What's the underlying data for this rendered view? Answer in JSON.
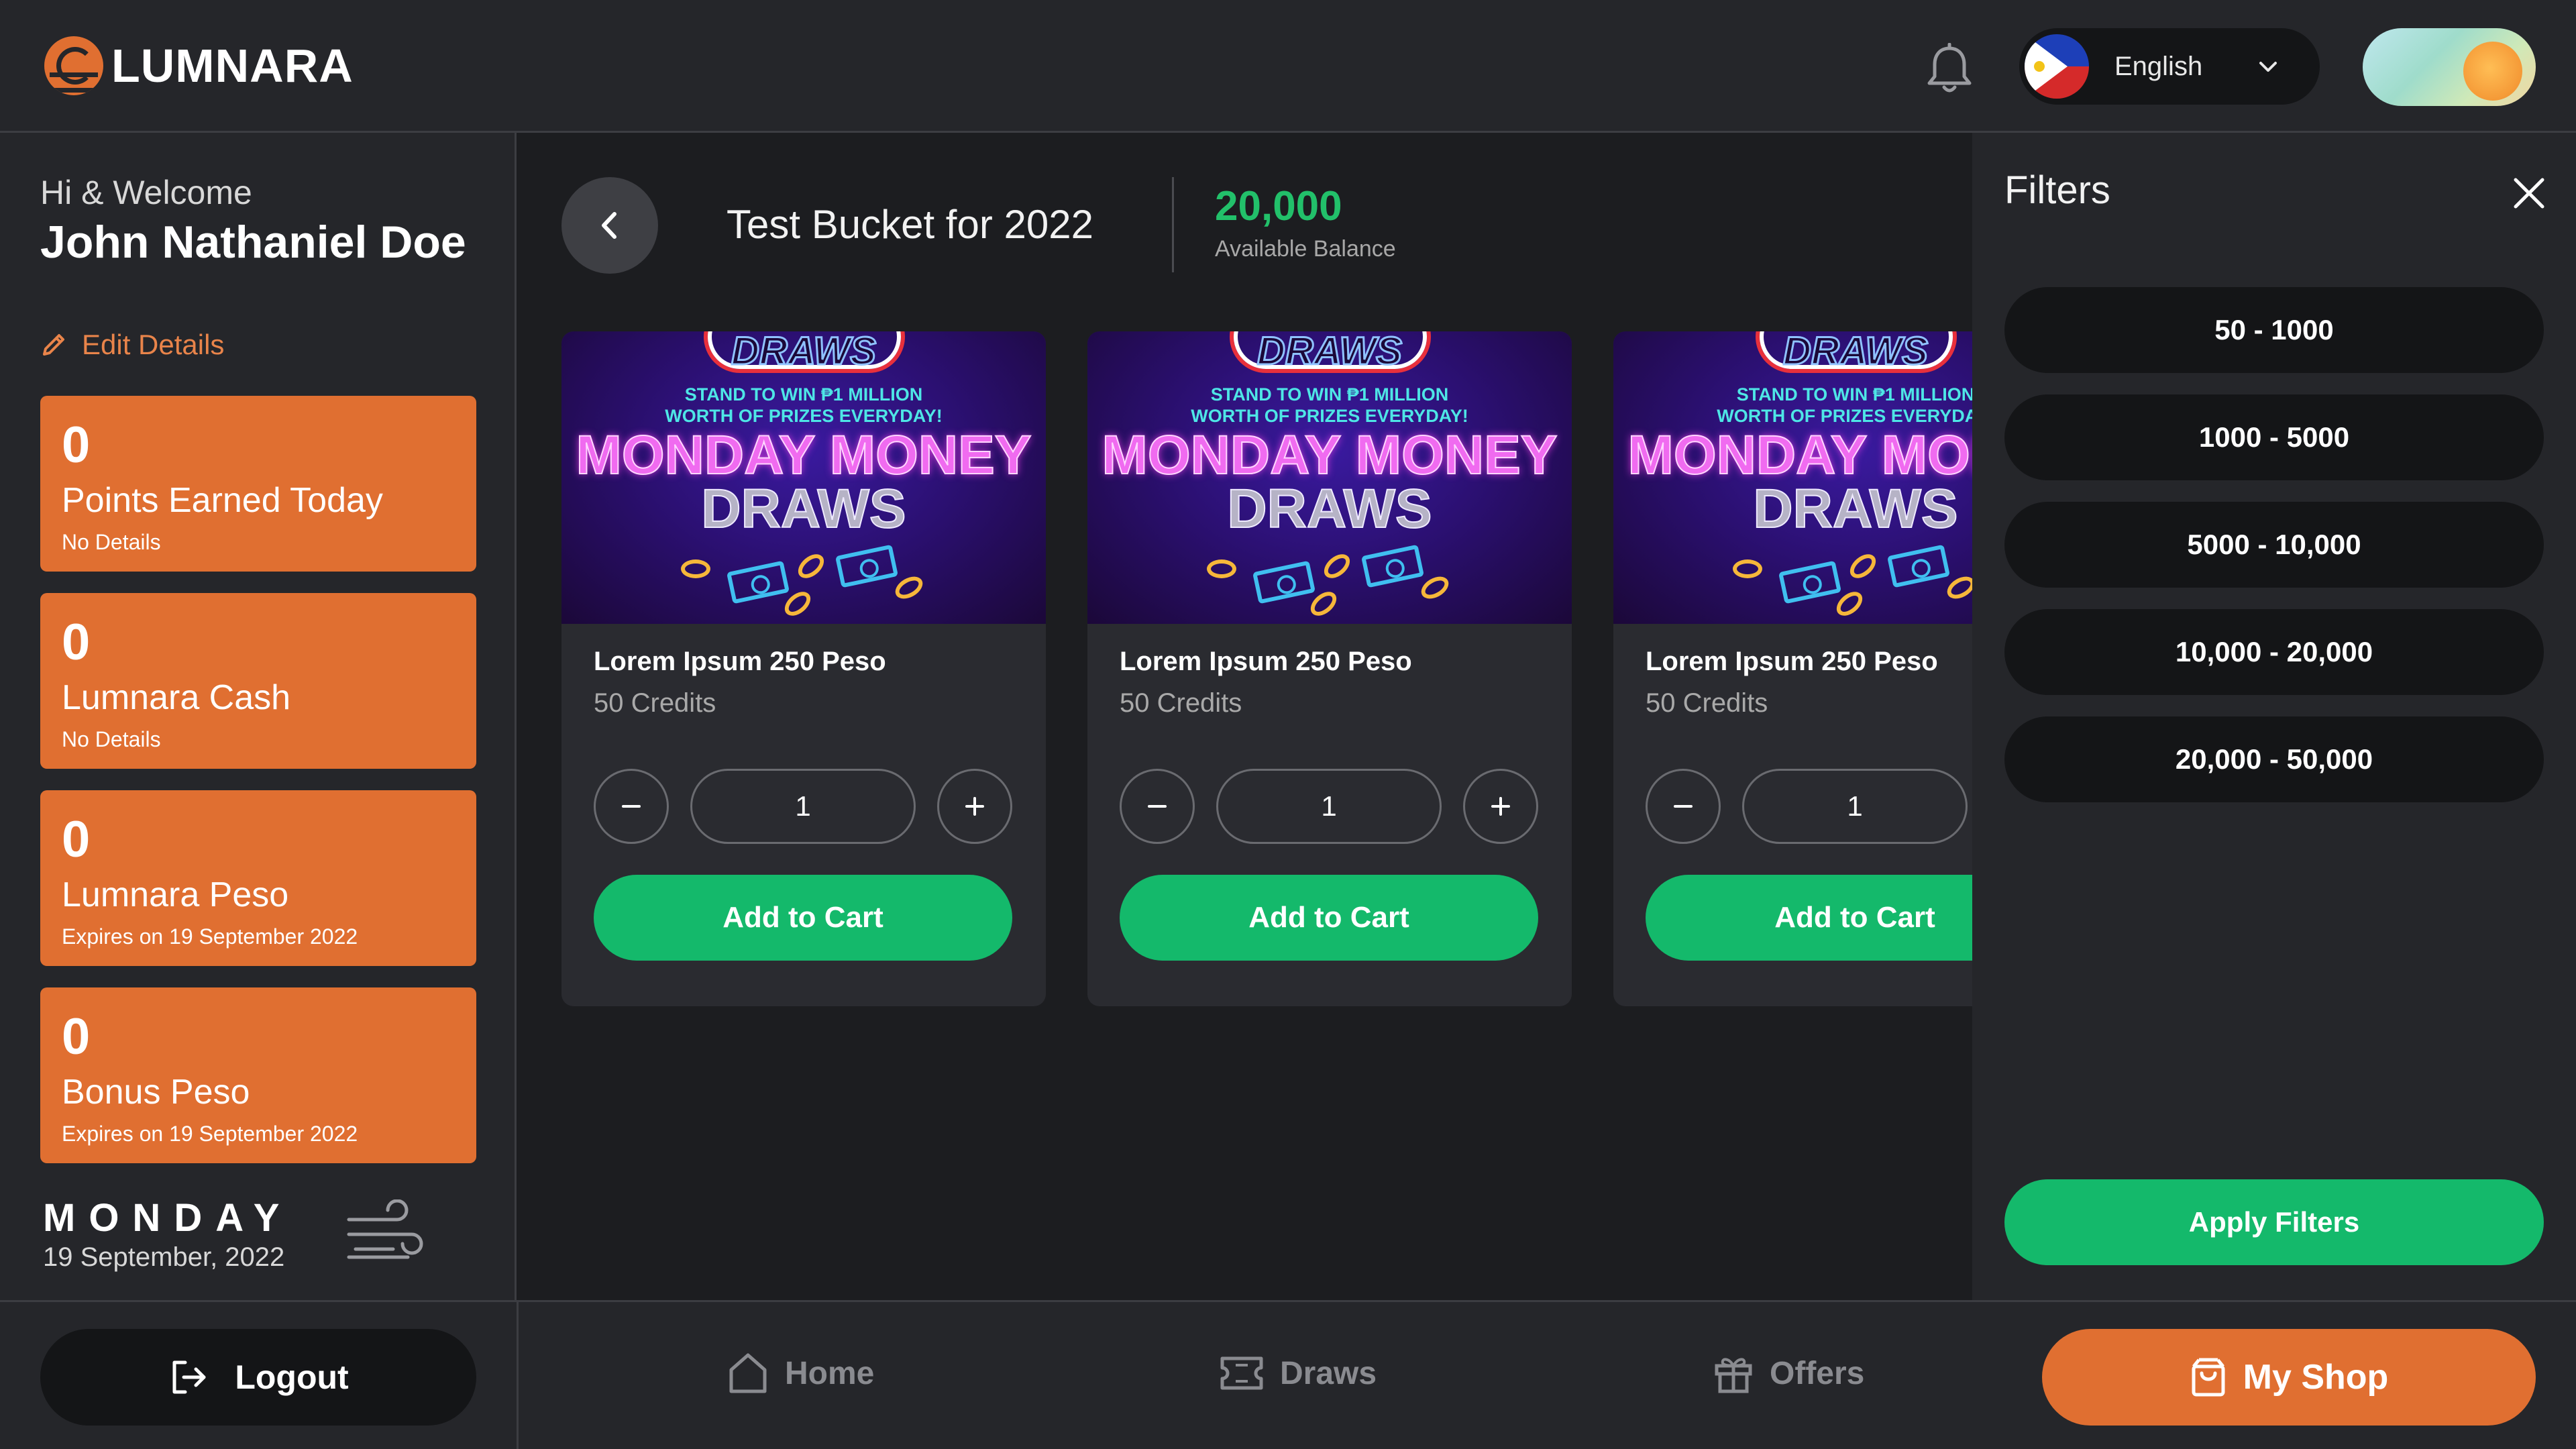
{
  "brand": {
    "name": "LUMNARA",
    "accent": "#e06f31",
    "green": "#14b96b"
  },
  "header": {
    "notifications_icon": "bell-icon",
    "language": {
      "label": "English",
      "flag": "philippines-flag-icon"
    }
  },
  "sidebar": {
    "greeting": "Hi & Welcome",
    "user_name": "John Nathaniel Doe",
    "edit_label": "Edit Details",
    "cards": [
      {
        "value": "0",
        "title": "Points Earned Today",
        "sub": "No Details"
      },
      {
        "value": "0",
        "title": "Lumnara Cash",
        "sub": "No Details"
      },
      {
        "value": "0",
        "title": "Lumnara Peso",
        "sub": "Expires on 19 September 2022"
      },
      {
        "value": "0",
        "title": "Bonus Peso",
        "sub": "Expires on 19 September 2022"
      }
    ],
    "day": "MONDAY",
    "date": "19 September, 2022",
    "weather_icon": "wind-icon"
  },
  "main": {
    "bucket_title": "Test Bucket for 2022",
    "balance_value": "20,000",
    "balance_label": "Available Balance",
    "banner": {
      "top": "DRAWS",
      "tagline_1": "STAND TO WIN ₱1 MILLION",
      "tagline_2": "WORTH OF PRIZES EVERYDAY!",
      "line_1": "MONDAY MONEY",
      "line_2": "DRAWS"
    },
    "products": [
      {
        "name": "Lorem Ipsum 250 Peso",
        "credits": "50 Credits",
        "qty": "1",
        "cta": "Add to Cart"
      },
      {
        "name": "Lorem Ipsum 250 Peso",
        "credits": "50 Credits",
        "qty": "1",
        "cta": "Add to Cart"
      },
      {
        "name": "Lorem Ipsum 250 Peso",
        "credits": "50 Credits",
        "qty": "1",
        "cta": "Add to Cart"
      }
    ]
  },
  "filters": {
    "title": "Filters",
    "ranges": [
      "50 - 1000",
      "1000 - 5000",
      "5000 - 10,000",
      "10,000 - 20,000",
      "20,000 - 50,000"
    ],
    "apply_label": "Apply Filters"
  },
  "bottom_nav": {
    "logout": "Logout",
    "home": "Home",
    "draws": "Draws",
    "offers": "Offers",
    "my_shop": "My Shop"
  }
}
